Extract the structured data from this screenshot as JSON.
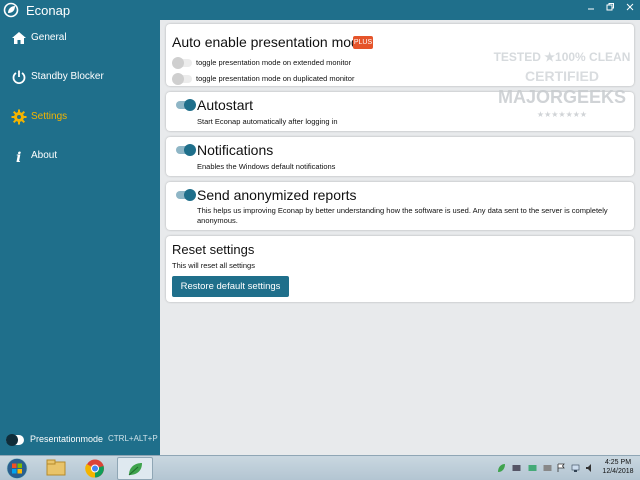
{
  "app": {
    "title": "Econap"
  },
  "window_controls": {
    "minimize_icon": "minimize-icon",
    "restore_icon": "restore-icon",
    "close_icon": "close-icon"
  },
  "sidebar": {
    "items": [
      {
        "label": "General",
        "icon": "home-icon",
        "active": false
      },
      {
        "label": "Standby Blocker",
        "icon": "power-icon",
        "active": false
      },
      {
        "label": "Settings",
        "icon": "gear-icon",
        "active": true
      },
      {
        "label": "About",
        "icon": "info-icon",
        "active": false
      }
    ],
    "presentation": {
      "label": "Presentationmode",
      "shortcut": "CTRL+ALT+P",
      "enabled": false
    }
  },
  "settings": {
    "presentation": {
      "title": "Auto enable presentation mode",
      "badge": "PLUS",
      "options": [
        {
          "label": "toggle presentation mode on extended monitor",
          "enabled": false
        },
        {
          "label": "toggle presentation mode on duplicated monitor",
          "enabled": false
        }
      ]
    },
    "autostart": {
      "title": "Autostart",
      "description": "Start Econap automatically after logging in",
      "enabled": true
    },
    "notifications": {
      "title": "Notifications",
      "description": "Enables the Windows default notifications",
      "enabled": true
    },
    "reports": {
      "title": "Send anonymized reports",
      "description": "This helps us improving Econap by better understanding how the software is used. Any data sent to the server is completely anonymous.",
      "enabled": true
    },
    "reset": {
      "title": "Reset settings",
      "description": "This will reset all settings",
      "button": "Restore default settings"
    }
  },
  "watermark": {
    "line1": "TESTED ★100% CLEAN",
    "line2": "CERTIFIED",
    "line3": "MAJORGEEKS",
    "line4": "★★★★★★★"
  },
  "taskbar": {
    "clock_time": "4:25 PM",
    "clock_date": "12/4/2018",
    "apps": [
      "start-orb-icon",
      "file-explorer-icon",
      "chrome-icon",
      "econap-leaf-icon"
    ]
  },
  "colors": {
    "accent": "#1f6f8b",
    "active_nav": "#f4b400",
    "badge": "#e5542a"
  }
}
